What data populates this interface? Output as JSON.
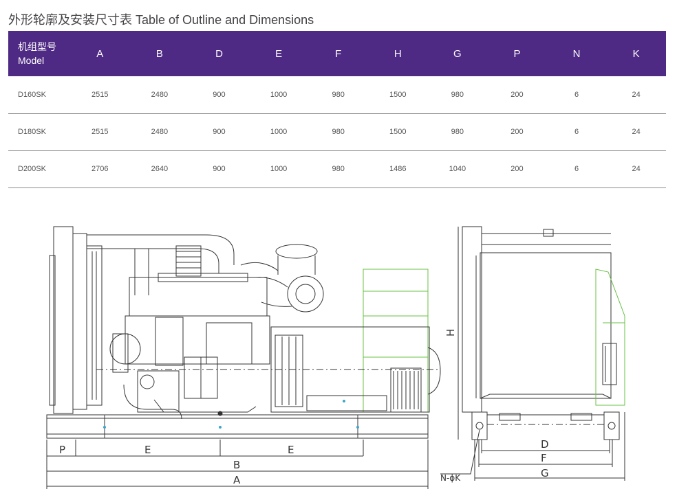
{
  "title": "外形轮廓及安装尺寸表 Table of Outline and Dimensions",
  "table": {
    "header_model_cn": "机组型号",
    "header_model_en": "Model",
    "columns": [
      "A",
      "B",
      "D",
      "E",
      "F",
      "H",
      "G",
      "P",
      "N",
      "K"
    ],
    "rows": [
      {
        "model": "D160SK",
        "values": [
          "2515",
          "2480",
          "900",
          "1000",
          "980",
          "1500",
          "980",
          "200",
          "6",
          "24"
        ]
      },
      {
        "model": "D180SK",
        "values": [
          "2515",
          "2480",
          "900",
          "1000",
          "980",
          "1500",
          "980",
          "200",
          "6",
          "24"
        ]
      },
      {
        "model": "D200SK",
        "values": [
          "2706",
          "2640",
          "900",
          "1000",
          "980",
          "1486",
          "1040",
          "200",
          "6",
          "24"
        ]
      }
    ]
  },
  "drawing": {
    "labels": {
      "p": "P",
      "e1": "E",
      "e2": "E",
      "b": "B",
      "a": "A",
      "h": "H",
      "d": "D",
      "f": "F",
      "g": "G",
      "nk": "N-ϕK"
    },
    "colors": {
      "header_bg": "#4e2a84",
      "line": "#333333",
      "alternator": "#6ac043",
      "center_mark": "#3aa7c9"
    }
  }
}
